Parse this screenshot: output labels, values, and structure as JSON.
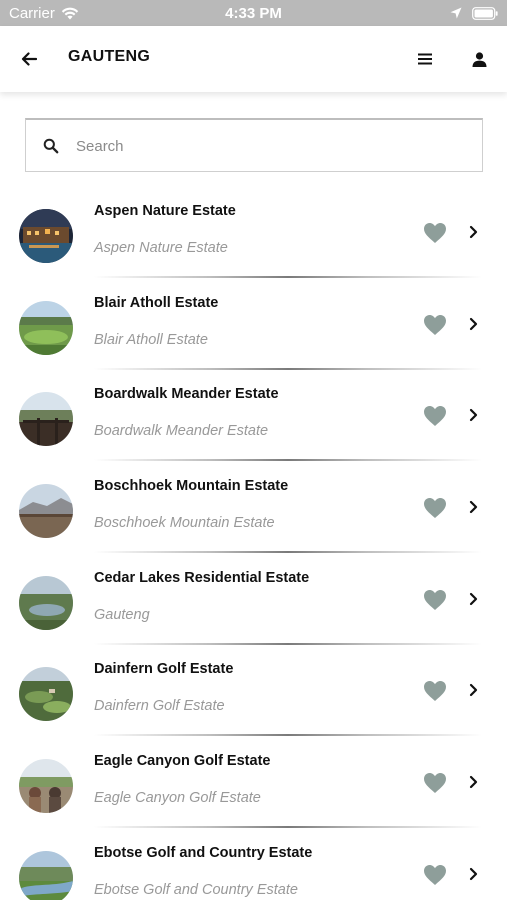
{
  "status_bar": {
    "carrier": "Carrier",
    "time": "4:33 PM"
  },
  "header": {
    "title": "GAUTENG"
  },
  "search": {
    "placeholder": "Search",
    "value": ""
  },
  "colors": {
    "heart": "#8e9e9a",
    "subtitle": "#999999",
    "status_bar_bg": "#b9b9b9"
  },
  "items": [
    {
      "title": "Aspen Nature Estate",
      "subtitle": "Aspen Nature Estate",
      "thumb": "night-estate-photo"
    },
    {
      "title": "Blair Atholl Estate",
      "subtitle": "Blair Atholl Estate",
      "thumb": "golf-course-photo"
    },
    {
      "title": "Boardwalk Meander Estate",
      "subtitle": "Boardwalk Meander Estate",
      "thumb": "boardwalk-photo"
    },
    {
      "title": "Boschhoek Mountain Estate",
      "subtitle": "Boschhoek Mountain Estate",
      "thumb": "mountain-photo"
    },
    {
      "title": "Cedar Lakes Residential Estate",
      "subtitle": "Gauteng",
      "thumb": "lake-photo"
    },
    {
      "title": "Dainfern Golf Estate",
      "subtitle": "Dainfern Golf Estate",
      "thumb": "golf-aerial-photo"
    },
    {
      "title": "Eagle Canyon Golf Estate",
      "subtitle": "Eagle Canyon Golf Estate",
      "thumb": "golfers-photo"
    },
    {
      "title": "Ebotse Golf and Country Estate",
      "subtitle": "Ebotse Golf and Country Estate",
      "thumb": "country-estate-photo"
    }
  ]
}
